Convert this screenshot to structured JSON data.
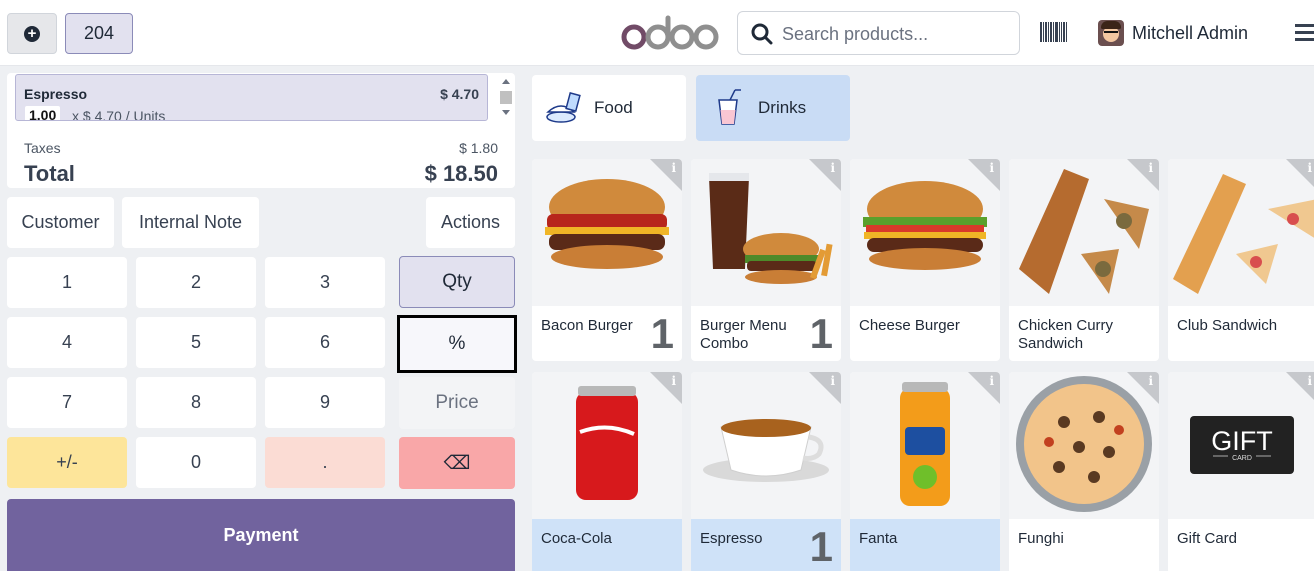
{
  "topbar": {
    "order_number": "204",
    "logo_text": "odoo",
    "search_placeholder": "Search products...",
    "user_name": "Mitchell Admin"
  },
  "order": {
    "lines": [
      {
        "name": "Espresso",
        "price": "$ 4.70",
        "qty": "1.00",
        "unit_text": "x $ 4.70 / Units"
      }
    ],
    "taxes_label": "Taxes",
    "taxes_value": "$ 1.80",
    "total_label": "Total",
    "total_value": "$ 18.50"
  },
  "controls": {
    "customer": "Customer",
    "internal_note": "Internal Note",
    "actions": "Actions"
  },
  "numpad": {
    "keys": [
      "1",
      "2",
      "3",
      "4",
      "5",
      "6",
      "7",
      "8",
      "9",
      "+/-",
      "0",
      "."
    ],
    "backspace": "⌫"
  },
  "modes": {
    "qty": "Qty",
    "discount": "%",
    "price": "Price",
    "active": "Qty"
  },
  "payment_label": "Payment",
  "categories": [
    {
      "label": "Food",
      "icon": "food-icon",
      "selected": false
    },
    {
      "label": "Drinks",
      "icon": "drinks-icon",
      "selected": true
    }
  ],
  "products": [
    {
      "name": "Bacon Burger",
      "qty": "1",
      "selected": false
    },
    {
      "name": "Burger Menu Combo",
      "qty": "1",
      "selected": false
    },
    {
      "name": "Cheese Burger",
      "qty": "",
      "selected": false
    },
    {
      "name": "Chicken Curry Sandwich",
      "qty": "",
      "selected": false
    },
    {
      "name": "Club Sandwich",
      "qty": "",
      "selected": false
    },
    {
      "name": "Coca-Cola",
      "qty": "",
      "selected": true
    },
    {
      "name": "Espresso",
      "qty": "1",
      "selected": true
    },
    {
      "name": "Fanta",
      "qty": "",
      "selected": true
    },
    {
      "name": "Funghi",
      "qty": "",
      "selected": false
    },
    {
      "name": "Gift Card",
      "qty": "",
      "selected": false
    }
  ],
  "gift_card_image_text": "GIFT",
  "gift_card_image_subtext": "CARD",
  "colors": {
    "brand": "#71639e",
    "selected_bg": "#cfe2f8",
    "mode_active": "#e2e1ef",
    "plusminus": "#fde59a",
    "dot": "#fbdcd4",
    "backspace": "#f9a7a8"
  }
}
